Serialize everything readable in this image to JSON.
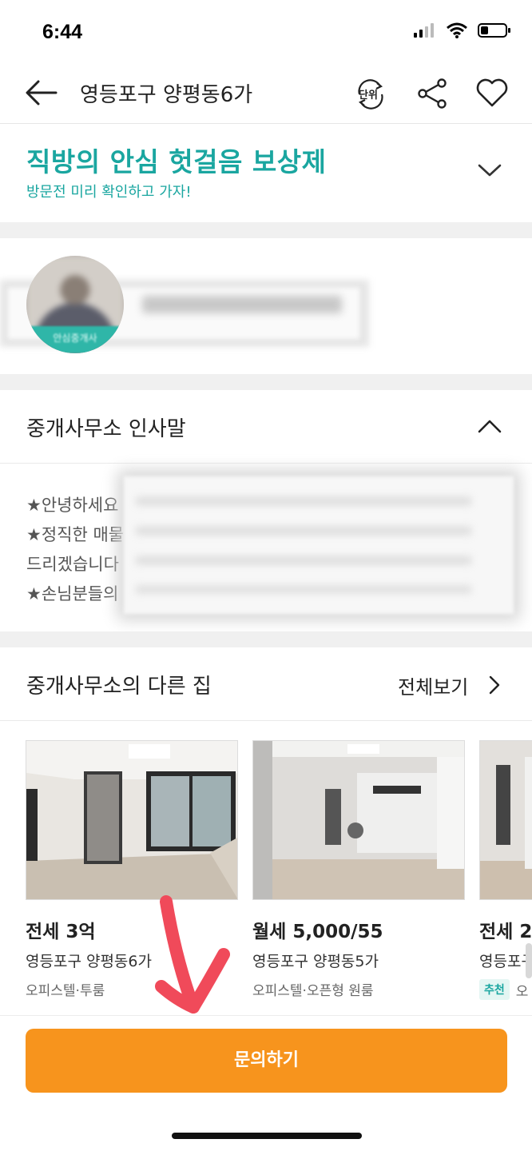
{
  "status_bar": {
    "time": "6:44"
  },
  "header": {
    "title": "영등포구 양평동6가",
    "unit_label": "단위"
  },
  "promo": {
    "title": "직방의 안심 헛걸음 보상제",
    "subtitle": "방문전 미리 확인하고 가자!"
  },
  "agent": {
    "badge": "안심중개사"
  },
  "greeting": {
    "title": "중개사무소 인사말",
    "lines": [
      "★안녕하세요",
      "★정직한 매물",
      "드리겠습니다",
      "★손님분들의"
    ]
  },
  "other_listings": {
    "title": "중개사무소의 다른 집",
    "see_all": "전체보기",
    "cards": [
      {
        "price": "전세 3억",
        "location": "영등포구 양평동6가",
        "type": "오피스텔·투룸",
        "badge": ""
      },
      {
        "price": "월세 5,000/55",
        "location": "영등포구 양평동5가",
        "type": "오피스텔·오픈형 원룸",
        "badge": ""
      },
      {
        "price": "전세 2",
        "location": "영등포구",
        "type": "오",
        "badge": "추천"
      }
    ]
  },
  "cta": {
    "label": "문의하기"
  },
  "colors": {
    "teal": "#1aa6a0",
    "orange": "#f7941d",
    "annotation_red": "#f04a5a"
  },
  "icons": [
    "back-arrow-icon",
    "unit-toggle-icon",
    "share-icon",
    "heart-icon",
    "chevron-down-icon",
    "chevron-up-icon",
    "chevron-right-icon"
  ]
}
